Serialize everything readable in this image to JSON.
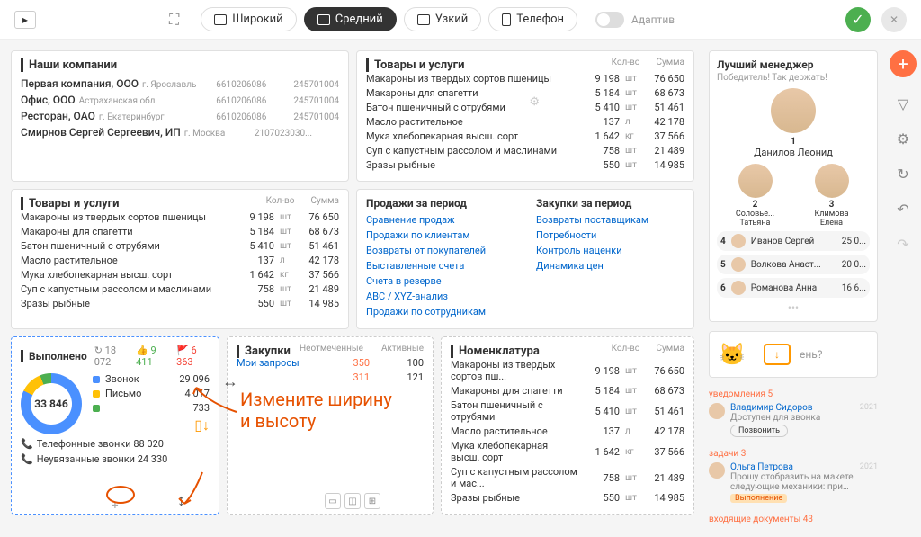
{
  "topbar": {
    "wide": "Широкий",
    "medium": "Средний",
    "narrow": "Узкий",
    "phone": "Телефон",
    "adaptive": "Адаптив"
  },
  "panels": {
    "companies": {
      "title": "Наши компании",
      "rows": [
        {
          "name": "Первая компания, ООО",
          "city": "г. Ярославль",
          "c1": "6610206086",
          "c2": "245701004"
        },
        {
          "name": "Офис, ООО",
          "city": "Астраханская обл.",
          "c1": "6610206086",
          "c2": "245701004"
        },
        {
          "name": "Ресторан, ОАО",
          "city": "г. Екатеринбург",
          "c1": "6610206086",
          "c2": "245701004"
        },
        {
          "name": "Смирнов Сергей Сергеевич, ИП",
          "city": "г. Москва",
          "c1": "2107023030...",
          "c2": ""
        }
      ]
    },
    "products_top": {
      "title": "Товары и услуги",
      "cols": {
        "qty": "Кол-во",
        "sum": "Сумма"
      },
      "rows": [
        {
          "name": "Макароны из твердых сортов пшеницы",
          "qty": "9 198",
          "unit": "шт",
          "sum": "76 650"
        },
        {
          "name": "Макароны для спагетти",
          "qty": "5 184",
          "unit": "шт",
          "sum": "68 673"
        },
        {
          "name": "Батон пшеничный с отрубями",
          "qty": "5 410",
          "unit": "шт",
          "sum": "51 461"
        },
        {
          "name": "Масло растительное",
          "qty": "137",
          "unit": "л",
          "sum": "42 178"
        },
        {
          "name": "Мука хлебопекарная высш. сорт",
          "qty": "1 642",
          "unit": "кг",
          "sum": "37 566"
        },
        {
          "name": "Суп с капустным рассолом и маслинами",
          "qty": "758",
          "unit": "шт",
          "sum": "21 489"
        },
        {
          "name": "Зразы рыбные",
          "qty": "550",
          "unit": "шт",
          "sum": "14 985"
        }
      ]
    },
    "products_left": {
      "title": "Товары и услуги",
      "cols": {
        "qty": "Кол-во",
        "sum": "Сумма"
      },
      "rows": [
        {
          "name": "Макароны из твердых сортов пшеницы",
          "qty": "9 198",
          "unit": "шт",
          "sum": "76 650"
        },
        {
          "name": "Макароны для спагетти",
          "qty": "5 184",
          "unit": "шт",
          "sum": "68 673"
        },
        {
          "name": "Батон пшеничный с отрубями",
          "qty": "5 410",
          "unit": "шт",
          "sum": "51 461"
        },
        {
          "name": "Масло растительное",
          "qty": "137",
          "unit": "л",
          "sum": "42 178"
        },
        {
          "name": "Мука хлебопекарная высш. сорт",
          "qty": "1 642",
          "unit": "кг",
          "sum": "37 566"
        },
        {
          "name": "Суп с капустным рассолом и маслинами",
          "qty": "758",
          "unit": "шт",
          "sum": "21 489"
        },
        {
          "name": "Зразы рыбные",
          "qty": "550",
          "unit": "шт",
          "sum": "14 985"
        }
      ]
    },
    "period_links": {
      "sales_title": "Продажи за период",
      "sales": [
        "Сравнение продаж",
        "Продажи по клиентам",
        "Возвраты от покупателей",
        "Выставленные счета",
        "Счета в резерве",
        "ABC / XYZ-анализ",
        "Продажи по сотрудникам"
      ],
      "purchases_title": "Закупки за период",
      "purchases": [
        "Возвраты поставщикам",
        "Потребности",
        "Контроль наценки",
        "Динамика цен"
      ]
    },
    "done": {
      "title": "Выполнено",
      "stats": [
        {
          "icon": "↻",
          "val": "18 072",
          "cls": "gray"
        },
        {
          "icon": "👍",
          "val": "9 411",
          "cls": "green"
        },
        {
          "icon": "🚩",
          "val": "6 363",
          "cls": "red"
        }
      ],
      "center": "33 846",
      "legend": [
        {
          "color": "#4a90ff",
          "label": "Звонок",
          "val": "29 096"
        },
        {
          "color": "#ffc107",
          "label": "Письмо",
          "val": "4 017"
        },
        {
          "color": "#4caf50",
          "label": "",
          "val": "733"
        }
      ],
      "phone1": "Телефонные звонки 88 020",
      "phone2": "Неувязанные звонки 24 330"
    },
    "zakupki": {
      "title": "Закупки",
      "cols": {
        "c1": "Неотмеченные",
        "c2": "Активные"
      },
      "rows": [
        {
          "label": "Мои запросы",
          "v1": "350",
          "v2": "100"
        },
        {
          "label": "",
          "v1": "311",
          "v2": "121"
        }
      ]
    },
    "nomenclature": {
      "title": "Номенклатура",
      "cols": {
        "qty": "Кол-во",
        "sum": "Сумма"
      },
      "rows": [
        {
          "name": "Макароны из твердых сортов пш...",
          "qty": "9 198",
          "unit": "шт",
          "sum": "76 650"
        },
        {
          "name": "Макароны для спагетти",
          "qty": "5 184",
          "unit": "шт",
          "sum": "68 673"
        },
        {
          "name": "Батон пшеничный с отрубями",
          "qty": "5 410",
          "unit": "шт",
          "sum": "51 461"
        },
        {
          "name": "Масло растительное",
          "qty": "137",
          "unit": "л",
          "sum": "42 178"
        },
        {
          "name": "Мука хлебопекарная высш. сорт",
          "qty": "1 642",
          "unit": "кг",
          "sum": "37 566"
        },
        {
          "name": "Суп с капустным рассолом и мас...",
          "qty": "758",
          "unit": "шт",
          "sum": "21 489"
        },
        {
          "name": "Зразы рыбные",
          "qty": "550",
          "unit": "шт",
          "sum": "14 985"
        }
      ]
    }
  },
  "sidebar": {
    "manager": {
      "title": "Лучший менеджер",
      "subtitle": "Победитель! Так держать!",
      "top": {
        "rank": "1",
        "name": "Данилов Леонид"
      },
      "two": [
        {
          "rank": "2",
          "name": "Соловье... Татьяна"
        },
        {
          "rank": "3",
          "name": "Климова Елена"
        }
      ],
      "list": [
        {
          "num": "4",
          "name": "Иванов Сергей",
          "score": "25 0..."
        },
        {
          "num": "5",
          "name": "Волкова Анаст...",
          "score": "20 0..."
        },
        {
          "num": "6",
          "name": "Романова Анна",
          "score": "16 6..."
        }
      ]
    },
    "promo_tail": "ень?",
    "notif_label": "уведомления",
    "notif_count": "5",
    "notif": {
      "name": "Владимир Сидоров",
      "sub": "Доступен для звонка",
      "year": "2021",
      "btn": "Позвонить"
    },
    "task_label": "задачи",
    "task_count": "3",
    "task": {
      "name": "Ольга Петрова",
      "text": "Прошу отобразить на макете следующие механики: при…",
      "year": "2021",
      "status": "Выполнение"
    },
    "docs_label": "входящие документы",
    "docs_count": "43"
  },
  "annotation": {
    "line1": "Измените ширину",
    "line2": "и высоту"
  },
  "chart_data": {
    "type": "pie",
    "title": "Выполнено",
    "total": 33846,
    "series": [
      {
        "name": "Звонок",
        "value": 29096,
        "color": "#4a90ff"
      },
      {
        "name": "Письмо",
        "value": 4017,
        "color": "#ffc107"
      },
      {
        "name": "",
        "value": 733,
        "color": "#4caf50"
      }
    ]
  }
}
